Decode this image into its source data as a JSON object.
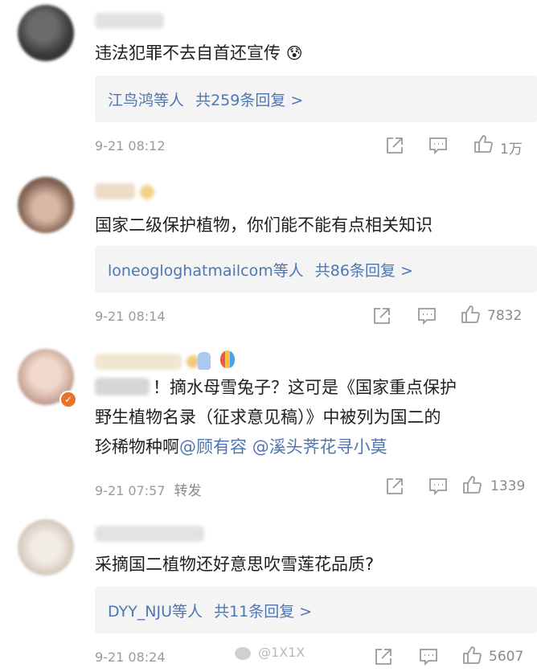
{
  "comments": [
    {
      "text": "违法犯罪不去自首还宣传",
      "emoji": "😰",
      "replies": {
        "names": "江鸟鸿等人",
        "total": "共259条回复 >"
      },
      "time": "9-21 08:12",
      "likes": "1万"
    },
    {
      "text": "国家二级保护植物，你们能不能有点相关知识",
      "replies": {
        "names": "loneogloghatmailcom等人",
        "total": "共86条回复 >"
      },
      "time": "9-21 08:14",
      "likes": "7832"
    },
    {
      "line1": "！摘水母雪兔子？这可是《国家重点保护",
      "line2": "野生植物名录（征求意见稿）》中被列为国二的",
      "line3_pre": "珍稀物种啊",
      "mention1": "@顾有容",
      "mention2": "@溪头荠花寻小莫",
      "time": "9-21 07:57",
      "forward": "转发",
      "likes": "1339"
    },
    {
      "text": "采摘国二植物还好意思吹雪莲花品质?",
      "replies": {
        "names": "DYY_NJU等人",
        "total": "共11条回复 >"
      },
      "time": "9-21 08:24",
      "likes": "5607"
    }
  ],
  "watermark": "@1X1X",
  "colors": {
    "link": "#4d76b3",
    "meta": "#9a9a9a",
    "reply_bg": "#f4f4f4"
  }
}
